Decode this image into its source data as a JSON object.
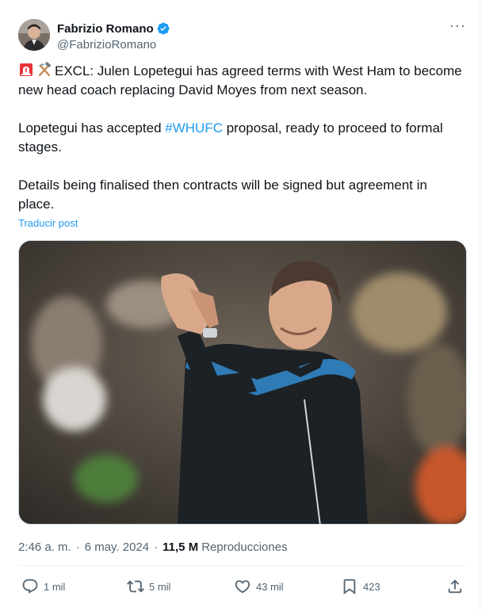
{
  "author": {
    "name": "Fabrizio Romano",
    "handle": "@FabrizioRomano",
    "verified": true
  },
  "more_label": "···",
  "tweet": {
    "line1_text": "EXCL: Julen Lopetegui has agreed terms with West Ham to become new head coach replacing David Moyes from next season.",
    "line1_emojis": [
      "rotating-light-emoji",
      "hammer-pick-emoji"
    ],
    "para2_before": "Lopetegui has accepted ",
    "para2_hashtag": "#WHUFC",
    "para2_after": " proposal, ready to proceed to formal stages.",
    "para3": "Details being finalised then contracts will be signed but agreement in place."
  },
  "translate_label": "Traducir post",
  "meta": {
    "time": "2:46 a. m.",
    "separator": "·",
    "date": "6 may. 2024",
    "views_count": "11,5 M",
    "views_label": "Reproducciones"
  },
  "actions": {
    "replies": "1 mil",
    "reposts": "5 mil",
    "likes": "43 mil",
    "bookmarks": "423"
  },
  "colors": {
    "accent": "#1d9bf0",
    "secondary_text": "#536471",
    "primary_text": "#0f1419"
  }
}
